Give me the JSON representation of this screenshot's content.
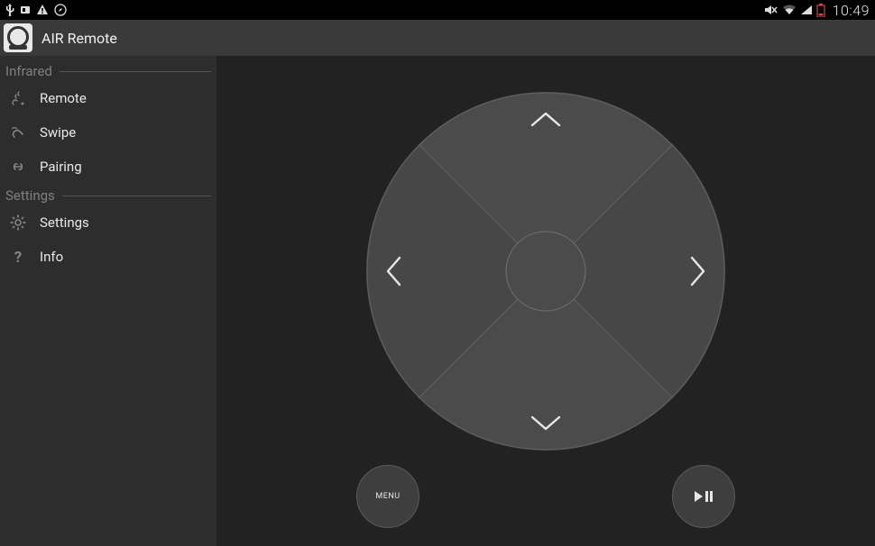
{
  "status": {
    "time": "10:49"
  },
  "header": {
    "title": "AIR Remote"
  },
  "sidebar": {
    "sections": [
      {
        "label": "Infrared",
        "items": [
          {
            "label": "Remote",
            "icon": "remote"
          },
          {
            "label": "Swipe",
            "icon": "swipe"
          },
          {
            "label": "Pairing",
            "icon": "pairing"
          }
        ]
      },
      {
        "label": "Settings",
        "items": [
          {
            "label": "Settings",
            "icon": "gear"
          },
          {
            "label": "Info",
            "icon": "info"
          }
        ]
      }
    ]
  },
  "controls": {
    "menu_button": "MENU"
  }
}
